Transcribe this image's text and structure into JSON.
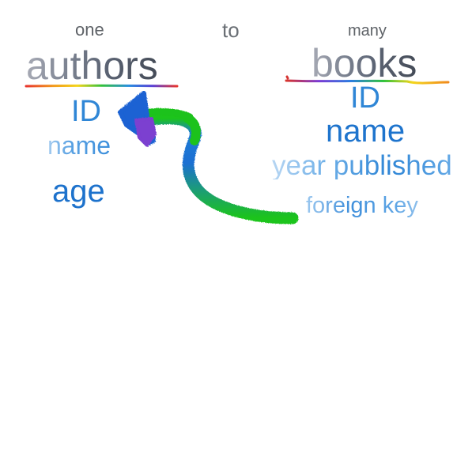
{
  "relationship": {
    "left_cardinality": "one",
    "connector": "to",
    "right_cardinality": "many"
  },
  "tables": {
    "authors": {
      "title": "authors",
      "fields": [
        "ID",
        "name",
        "age"
      ]
    },
    "books": {
      "title": "books",
      "fields": [
        "ID",
        "name",
        "year published",
        "foreign key"
      ]
    }
  },
  "colors": {
    "field_blue": "#1f7ad1",
    "arrow_head": "#1d5fd0",
    "arrow_purple": "#7b3fd0",
    "arrow_green": "#19c214"
  }
}
